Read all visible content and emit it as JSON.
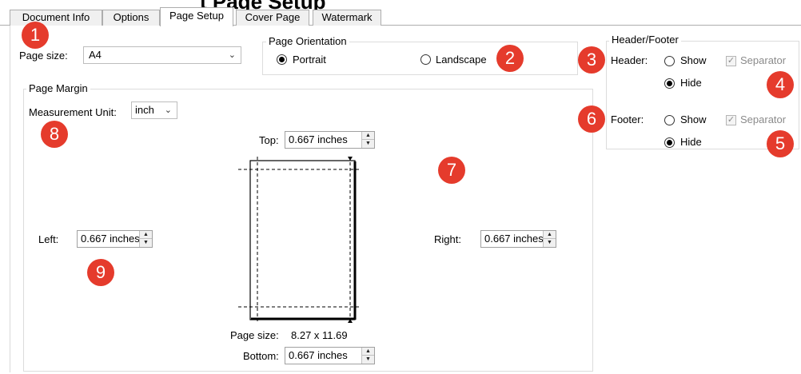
{
  "heading_fragment": "t Page Setup",
  "tabs": [
    {
      "label": "Document Info",
      "active": false
    },
    {
      "label": "Options",
      "active": false
    },
    {
      "label": "Page Setup",
      "active": true
    },
    {
      "label": "Cover Page",
      "active": false
    },
    {
      "label": "Watermark",
      "active": false
    }
  ],
  "page_size": {
    "label": "Page size:",
    "value": "A4"
  },
  "orientation": {
    "title": "Page Orientation",
    "portrait_label": "Portrait",
    "landscape_label": "Landscape",
    "selected": "Portrait"
  },
  "header_footer": {
    "title": "Header/Footer",
    "header_label": "Header:",
    "footer_label": "Footer:",
    "show_label": "Show",
    "hide_label": "Hide",
    "separator_label": "Separator",
    "header_selected": "Hide",
    "footer_selected": "Hide",
    "header_separator_checked": true,
    "footer_separator_checked": true
  },
  "margin": {
    "title": "Page Margin",
    "unit_label": "Measurement Unit:",
    "unit_value": "inch",
    "top_label": "Top:",
    "top_value": "0.667 inches",
    "left_label": "Left:",
    "left_value": "0.667 inches",
    "right_label": "Right:",
    "right_value": "0.667 inches",
    "bottom_label": "Bottom:",
    "bottom_value": "0.667 inches",
    "page_size_label": "Page size:",
    "page_size_value": "8.27 x 11.69"
  },
  "callouts": [
    "1",
    "2",
    "3",
    "4",
    "5",
    "6",
    "7",
    "8",
    "9"
  ]
}
